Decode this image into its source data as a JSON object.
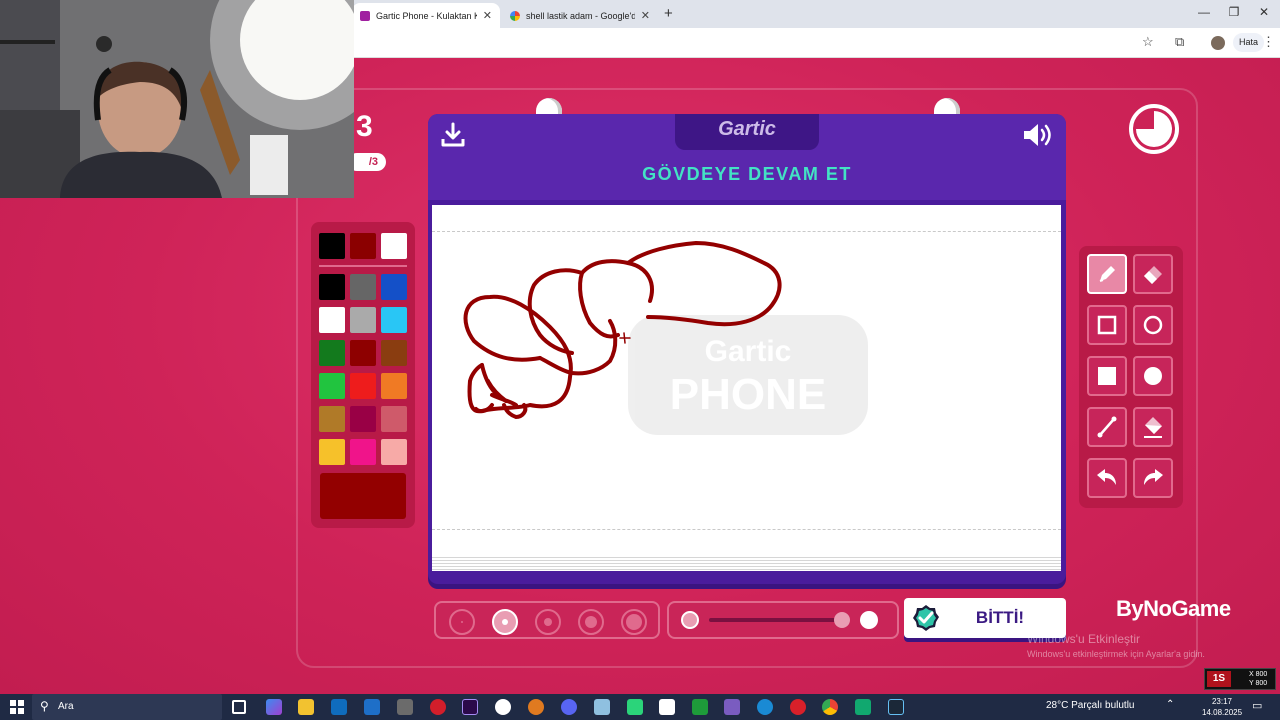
{
  "browser": {
    "tabs": [
      {
        "title": "Gartic Phone - Kulaktan Kulağa",
        "active": true
      },
      {
        "title": "shell lastik adam - Google'da A...",
        "active": false
      }
    ],
    "profile_label": "Hata"
  },
  "game": {
    "round_number": "3",
    "round_of": "/3",
    "logo": "Gartic",
    "watermark_line1": "Gartic",
    "watermark_line2": "PHONE",
    "task_title": "GÖVDEYE DEVAM ET",
    "done_label": "BİTTİ!",
    "current_color": "#930000",
    "palette": [
      "#000000",
      "#8b0000",
      "#ffffff",
      "#000000",
      "#666666",
      "#1450c8",
      "#ffffff",
      "#aaaaaa",
      "#29c6f5",
      "#137a1d",
      "#8e0000",
      "#8a3d10",
      "#21c43f",
      "#ee1c1c",
      "#f07a24",
      "#b07a28",
      "#990045",
      "#cf5a6a",
      "#f6c12a",
      "#f0148a",
      "#f7aaa7"
    ],
    "tools": [
      "pencil-icon",
      "eraser-icon",
      "rect-outline-icon",
      "circle-outline-icon",
      "rect-filled-icon",
      "circle-filled-icon",
      "line-icon",
      "fill-bucket-icon",
      "undo-icon",
      "redo-icon"
    ],
    "active_tool": "pencil-icon",
    "brush_size_selected": 2,
    "opacity_level": 1.0
  },
  "overlay": {
    "brand": "ByNoGame",
    "windows_activate_title": "Windows'u Etkinleştir",
    "windows_activate_sub": "Windows'u etkinleştirmek için Ayarlar'a gidin.",
    "fps_x": "X 800",
    "fps_y": "Y 800"
  },
  "taskbar": {
    "search_placeholder": "Ara",
    "weather": "28°C  Parçalı bulutlu",
    "time": "23:17",
    "date": "14.08.2025"
  }
}
